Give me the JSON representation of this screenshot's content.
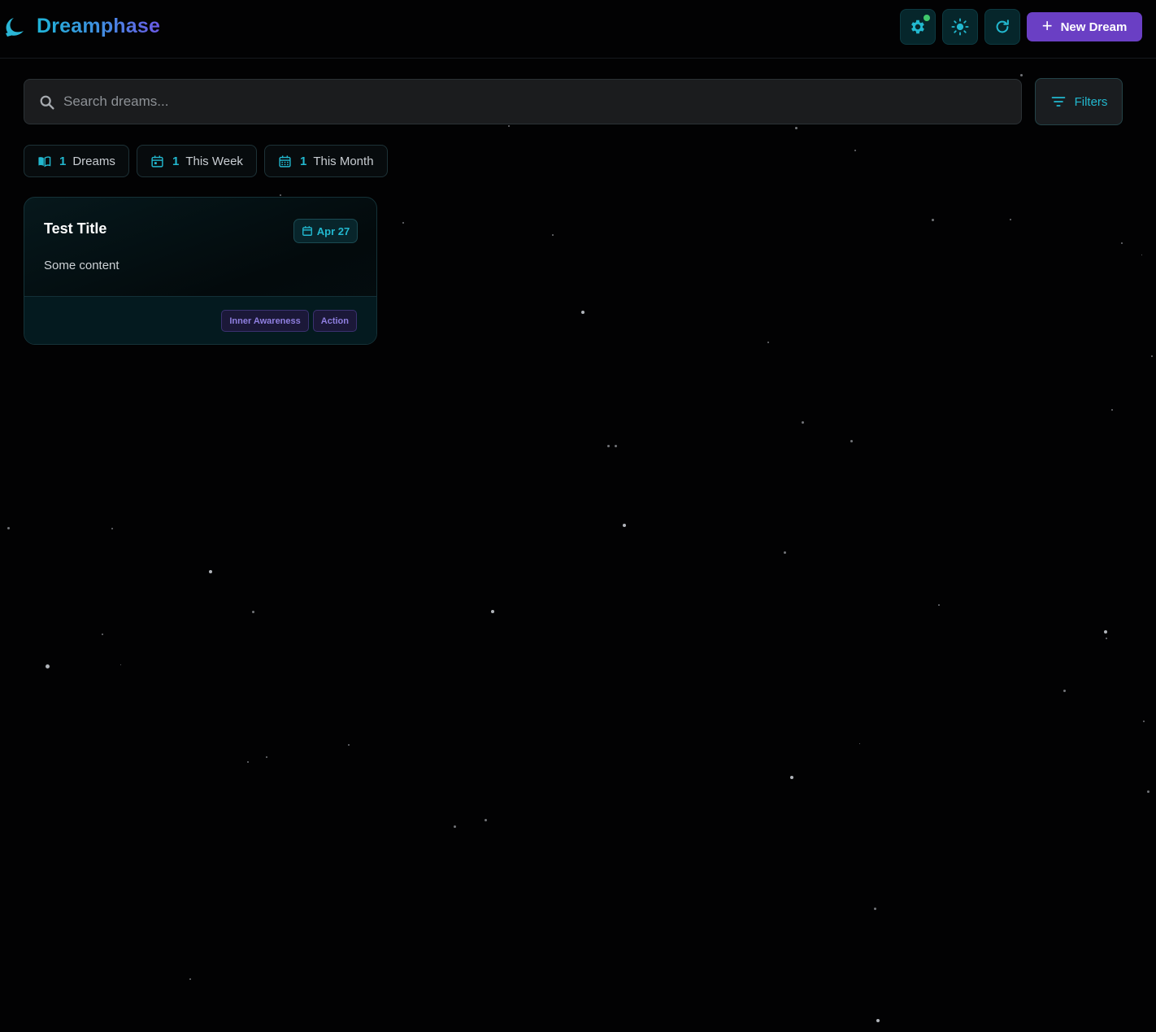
{
  "app": {
    "brand": "Dreamphase",
    "logo_icon": "moon-icon",
    "accent_color": "#22b8cf",
    "primary_color": "#6a3fc4"
  },
  "header": {
    "settings_icon": "gear-icon",
    "settings_has_notification": true,
    "theme_icon": "sun-icon",
    "refresh_icon": "refresh-icon",
    "new_button_label": "New Dream",
    "new_button_icon": "plus-icon"
  },
  "search": {
    "placeholder": "Search dreams...",
    "value": "",
    "icon": "search-icon",
    "filters_label": "Filters",
    "filters_icon": "filter-icon"
  },
  "stats": [
    {
      "icon": "book-open-icon",
      "count": "1",
      "label": "Dreams"
    },
    {
      "icon": "calendar-week-icon",
      "count": "1",
      "label": "This Week"
    },
    {
      "icon": "calendar-month-icon",
      "count": "1",
      "label": "This Month"
    }
  ],
  "dreams": [
    {
      "title": "Test Title",
      "date": "Apr 27",
      "content": "Some content",
      "tags": [
        "Inner Awareness",
        "Action"
      ]
    }
  ]
}
